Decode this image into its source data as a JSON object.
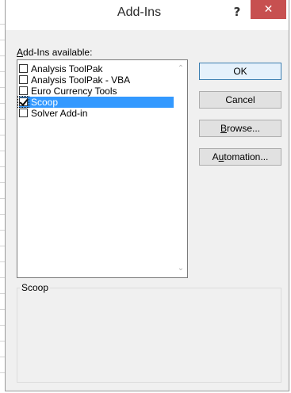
{
  "dialog": {
    "title": "Add-Ins",
    "help_label": "?",
    "close_label": "✕"
  },
  "list": {
    "label_accel": "A",
    "label_rest": "dd-Ins available:",
    "items": [
      {
        "label": "Analysis ToolPak",
        "checked": false
      },
      {
        "label": "Analysis ToolPak - VBA",
        "checked": false
      },
      {
        "label": "Euro Currency Tools",
        "checked": false
      },
      {
        "label": "Scoop",
        "checked": true,
        "selected": true
      },
      {
        "label": "Solver Add-in",
        "checked": false
      }
    ],
    "scroll_up": "⌃",
    "scroll_down": "⌄"
  },
  "buttons": {
    "ok": "OK",
    "cancel": "Cancel",
    "browse_accel": "B",
    "browse_rest": "rowse...",
    "automation_pre": "A",
    "automation_accel": "u",
    "automation_rest": "tomation..."
  },
  "description": {
    "title": "Scoop"
  },
  "colors": {
    "selection": "#3399ff",
    "close_button": "#c75050"
  }
}
